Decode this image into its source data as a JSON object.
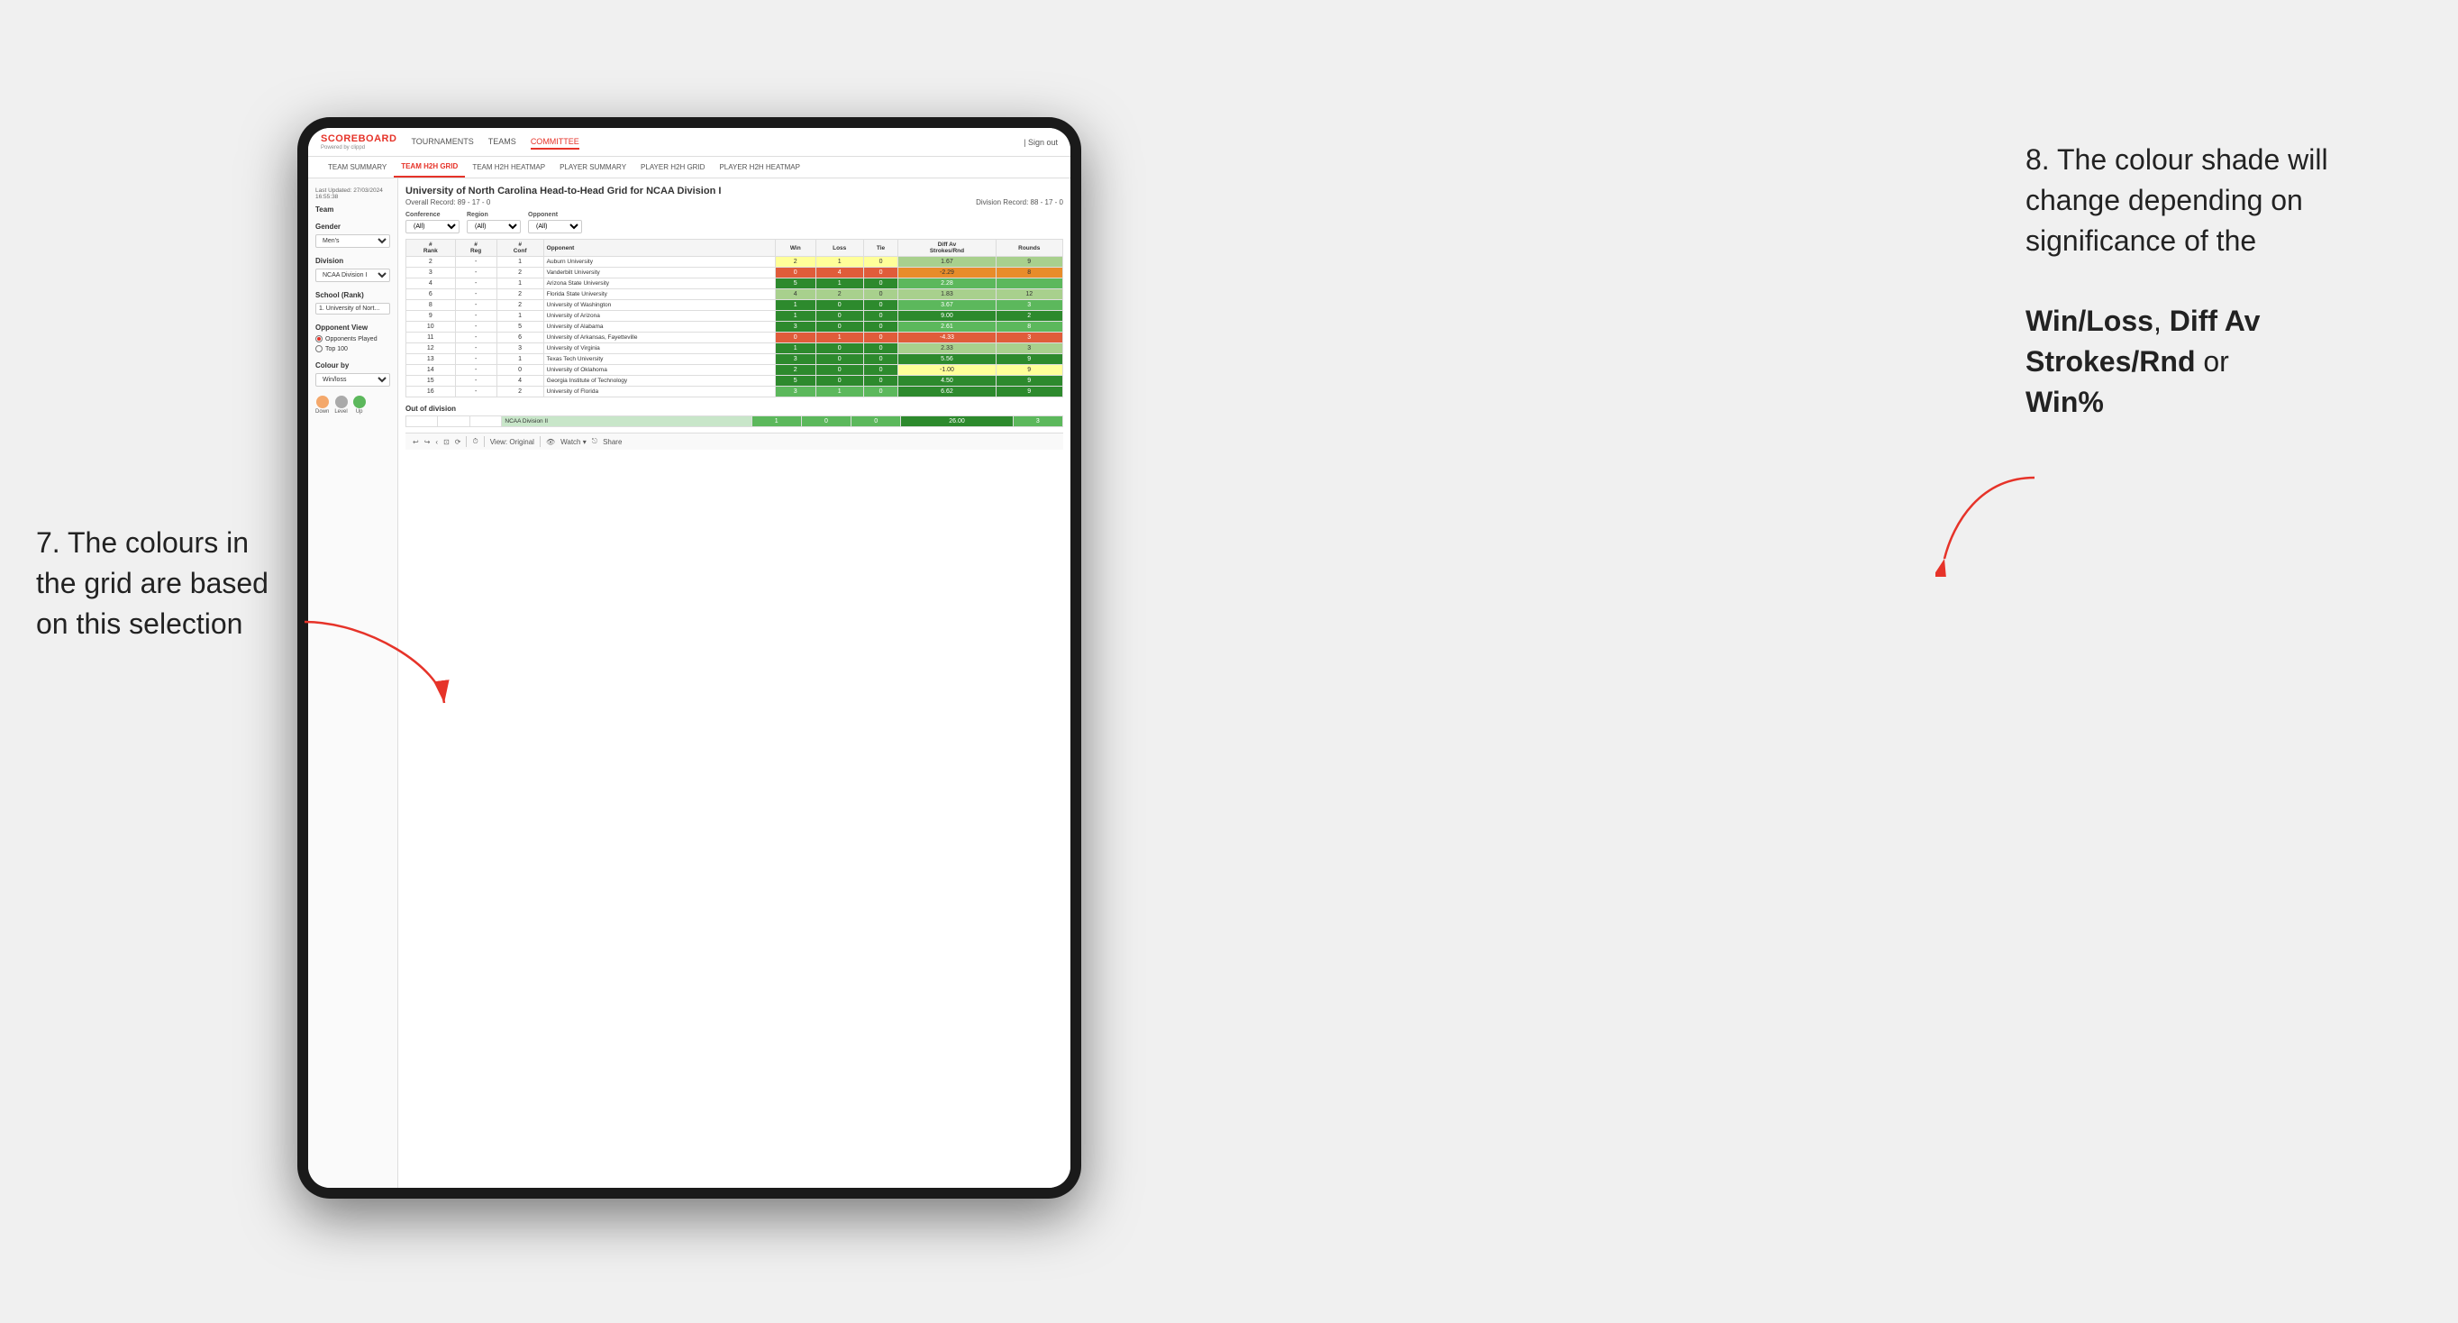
{
  "annotations": {
    "left_title": "7. The colours in the grid are based on this selection",
    "right_title": "8. The colour shade will change depending on significance of the",
    "right_bold1": "Win/Loss",
    "right_comma": ", ",
    "right_bold2": "Diff Av Strokes/Rnd",
    "right_or": " or",
    "right_bold3": "Win%"
  },
  "nav": {
    "logo": "SCOREBOARD",
    "logo_sub": "Powered by clippd",
    "links": [
      "TOURNAMENTS",
      "TEAMS",
      "COMMITTEE"
    ],
    "sign_out": "Sign out"
  },
  "sub_nav": {
    "links": [
      "TEAM SUMMARY",
      "TEAM H2H GRID",
      "TEAM H2H HEATMAP",
      "PLAYER SUMMARY",
      "PLAYER H2H GRID",
      "PLAYER H2H HEATMAP"
    ]
  },
  "sidebar": {
    "timestamp": "Last Updated: 27/03/2024 16:55:38",
    "team_label": "Team",
    "gender_label": "Gender",
    "gender_value": "Men's",
    "division_label": "Division",
    "division_value": "NCAA Division I",
    "school_label": "School (Rank)",
    "school_value": "1. University of Nort...",
    "opponent_view_label": "Opponent View",
    "radio1": "Opponents Played",
    "radio2": "Top 100",
    "colour_by_label": "Colour by",
    "colour_by_value": "Win/loss",
    "legend": {
      "down_label": "Down",
      "level_label": "Level",
      "up_label": "Up",
      "down_color": "#f4a86b",
      "level_color": "#aaaaaa",
      "up_color": "#5cb85c"
    }
  },
  "report": {
    "title": "University of North Carolina Head-to-Head Grid for NCAA Division I",
    "overall_record": "Overall Record: 89 - 17 - 0",
    "division_record": "Division Record: 88 - 17 - 0",
    "conference_label": "Conference",
    "region_label": "Region",
    "opponent_label": "Opponent",
    "opponents_label": "Opponents:",
    "opponents_value": "(All)",
    "region_value": "(All)",
    "opponent_value": "(All)"
  },
  "grid": {
    "headers": [
      "#\nRank",
      "#\nReg",
      "#\nConf",
      "Opponent",
      "Win",
      "Loss",
      "Tie",
      "Diff Av\nStrokes/Rnd",
      "Rounds"
    ],
    "rows": [
      {
        "rank": "2",
        "reg": "-",
        "conf": "1",
        "opponent": "Auburn University",
        "win": "2",
        "loss": "1",
        "tie": "0",
        "diff": "1.67",
        "rounds": "9",
        "win_color": "yellow",
        "diff_color": "green_light"
      },
      {
        "rank": "3",
        "reg": "-",
        "conf": "2",
        "opponent": "Vanderbilt University",
        "win": "0",
        "loss": "4",
        "tie": "0",
        "diff": "-2.29",
        "rounds": "8",
        "win_color": "red",
        "diff_color": "orange"
      },
      {
        "rank": "4",
        "reg": "-",
        "conf": "1",
        "opponent": "Arizona State University",
        "win": "5",
        "loss": "1",
        "tie": "0",
        "diff": "2.28",
        "rounds": "",
        "win_color": "green_dark",
        "diff_color": "green_med"
      },
      {
        "rank": "6",
        "reg": "-",
        "conf": "2",
        "opponent": "Florida State University",
        "win": "4",
        "loss": "2",
        "tie": "0",
        "diff": "1.83",
        "rounds": "12",
        "win_color": "green_light",
        "diff_color": "green_light"
      },
      {
        "rank": "8",
        "reg": "-",
        "conf": "2",
        "opponent": "University of Washington",
        "win": "1",
        "loss": "0",
        "tie": "0",
        "diff": "3.67",
        "rounds": "3",
        "win_color": "green_dark",
        "diff_color": "green_med"
      },
      {
        "rank": "9",
        "reg": "-",
        "conf": "1",
        "opponent": "University of Arizona",
        "win": "1",
        "loss": "0",
        "tie": "0",
        "diff": "9.00",
        "rounds": "2",
        "win_color": "green_dark",
        "diff_color": "green_dark"
      },
      {
        "rank": "10",
        "reg": "-",
        "conf": "5",
        "opponent": "University of Alabama",
        "win": "3",
        "loss": "0",
        "tie": "0",
        "diff": "2.61",
        "rounds": "8",
        "win_color": "green_dark",
        "diff_color": "green_med"
      },
      {
        "rank": "11",
        "reg": "-",
        "conf": "6",
        "opponent": "University of Arkansas, Fayetteville",
        "win": "0",
        "loss": "1",
        "tie": "0",
        "diff": "-4.33",
        "rounds": "3",
        "win_color": "red",
        "diff_color": "red"
      },
      {
        "rank": "12",
        "reg": "-",
        "conf": "3",
        "opponent": "University of Virginia",
        "win": "1",
        "loss": "0",
        "tie": "0",
        "diff": "2.33",
        "rounds": "3",
        "win_color": "green_dark",
        "diff_color": "green_light"
      },
      {
        "rank": "13",
        "reg": "-",
        "conf": "1",
        "opponent": "Texas Tech University",
        "win": "3",
        "loss": "0",
        "tie": "0",
        "diff": "5.56",
        "rounds": "9",
        "win_color": "green_dark",
        "diff_color": "green_dark"
      },
      {
        "rank": "14",
        "reg": "-",
        "conf": "0",
        "opponent": "University of Oklahoma",
        "win": "2",
        "loss": "0",
        "tie": "0",
        "diff": "-1.00",
        "rounds": "9",
        "win_color": "green_dark",
        "diff_color": "yellow"
      },
      {
        "rank": "15",
        "reg": "-",
        "conf": "4",
        "opponent": "Georgia Institute of Technology",
        "win": "5",
        "loss": "0",
        "tie": "0",
        "diff": "4.50",
        "rounds": "9",
        "win_color": "green_dark",
        "diff_color": "green_dark"
      },
      {
        "rank": "16",
        "reg": "-",
        "conf": "2",
        "opponent": "University of Florida",
        "win": "3",
        "loss": "1",
        "tie": "0",
        "diff": "6.62",
        "rounds": "9",
        "win_color": "green_med",
        "diff_color": "green_dark"
      }
    ],
    "out_of_division_label": "Out of division",
    "out_of_division_row": {
      "division": "NCAA Division II",
      "win": "1",
      "loss": "0",
      "tie": "0",
      "diff": "26.00",
      "rounds": "3"
    }
  },
  "toolbar": {
    "view_label": "View: Original",
    "watch_label": "Watch ▾",
    "share_label": "Share"
  }
}
